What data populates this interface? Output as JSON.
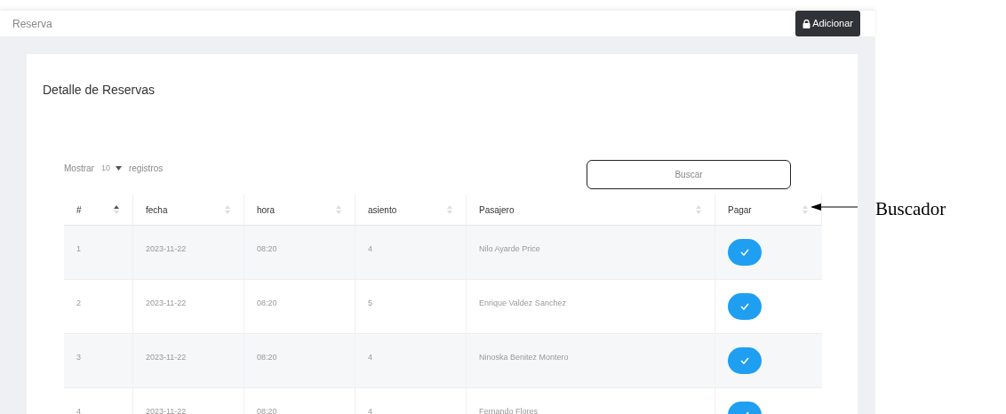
{
  "header": {
    "title": "Reserva",
    "add_button": "Adicionar"
  },
  "card": {
    "title": "Detalle de Reservas",
    "length_menu": {
      "label_before": "Mostrar",
      "value": "10",
      "label_after": "registros"
    },
    "search": {
      "placeholder": "Buscar"
    },
    "table": {
      "columns": [
        {
          "label": "#",
          "sorted": true
        },
        {
          "label": "fecha",
          "sorted": false
        },
        {
          "label": "hora",
          "sorted": false
        },
        {
          "label": "asiento",
          "sorted": false
        },
        {
          "label": "Pasajero",
          "sorted": false
        },
        {
          "label": "Pagar",
          "sorted": false
        }
      ],
      "rows": [
        [
          "1",
          "2023-11-22",
          "08:20",
          "4",
          "Nilo Ayarde Price"
        ],
        [
          "2",
          "2023-11-22",
          "08:20",
          "5",
          "Enrique Valdez Sanchez"
        ],
        [
          "3",
          "2023-11-22",
          "08:20",
          "4",
          "Ninoska Benitez Montero"
        ],
        [
          "4",
          "2023-11-22",
          "08:20",
          "4",
          "Fernando Flores"
        ]
      ]
    }
  },
  "annotation": {
    "label": "Buscador"
  }
}
